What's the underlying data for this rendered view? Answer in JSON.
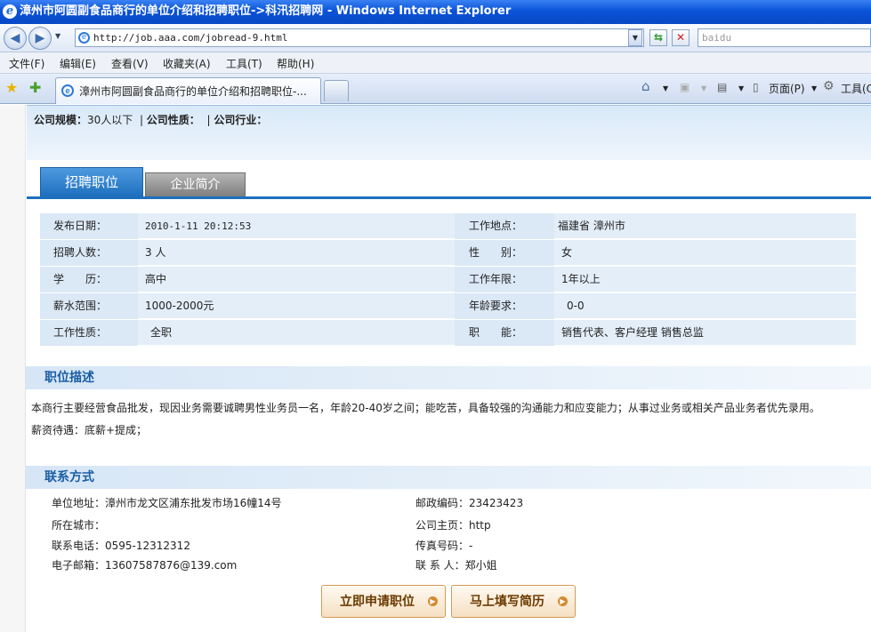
{
  "window": {
    "title": "漳州市阿圆副食品商行的单位介绍和招聘职位->科汛招聘网 - Windows Internet Explorer"
  },
  "addressbar": {
    "url": "http://job.aaa.com/jobread-9.html",
    "search_placeholder": "baidu"
  },
  "menu": [
    "文件(F)",
    "编辑(E)",
    "查看(V)",
    "收藏夹(A)",
    "工具(T)",
    "帮助(H)"
  ],
  "tab": {
    "title": "漳州市阿圆副食品商行的单位介绍和招聘职位-..."
  },
  "commandbar": {
    "page": "页面(P)",
    "tools": "工具(O)"
  },
  "company": {
    "size_label": "公司规模：",
    "size_value": "30人以下",
    "nature_label": "公司性质：",
    "industry_label": "公司行业："
  },
  "tabs": {
    "jobs": "招聘职位",
    "intro": "企业简介"
  },
  "details": [
    {
      "l1": "发布日期：",
      "v1": "2010-1-11 20:12:53",
      "l2": "工作地点：",
      "v2": "福建省 漳州市"
    },
    {
      "l1": "招聘人数：",
      "v1": "3 人",
      "l2": "性　　别：",
      "v2": "女"
    },
    {
      "l1": "学　　历：",
      "v1": "高中",
      "l2": "工作年限：",
      "v2": "1年以上"
    },
    {
      "l1": "薪水范围：",
      "v1": "1000-2000元",
      "l2": "年龄要求：",
      "v2": "0-0"
    },
    {
      "l1": "工作性质：",
      "v1": "全职",
      "l2": "职　　能：",
      "v2": "销售代表、客户经理 销售总监"
    }
  ],
  "description": {
    "heading": "职位描述",
    "line1": "本商行主要经营食品批发，现因业务需要诚聘男性业务员一名，年龄20-40岁之间；能吃苦，具备较强的沟通能力和应变能力；从事过业务或相关产品业务者优先录用。",
    "line2": "薪资待遇：底薪+提成；"
  },
  "contact": {
    "heading": "联系方式",
    "address": "单位地址：漳州市龙文区浦东批发市场16幢14号",
    "postcode": "邮政编码：23423423",
    "city": "所在城市：",
    "homepage": "公司主页：http",
    "phone": "联系电话：0595-12312312",
    "fax": "传真号码：-",
    "email": "电子邮箱：13607587876@139.com",
    "person": "联 系 人：郑小姐"
  },
  "actions": {
    "apply": "立即申请职位",
    "resume": "马上填写简历"
  }
}
